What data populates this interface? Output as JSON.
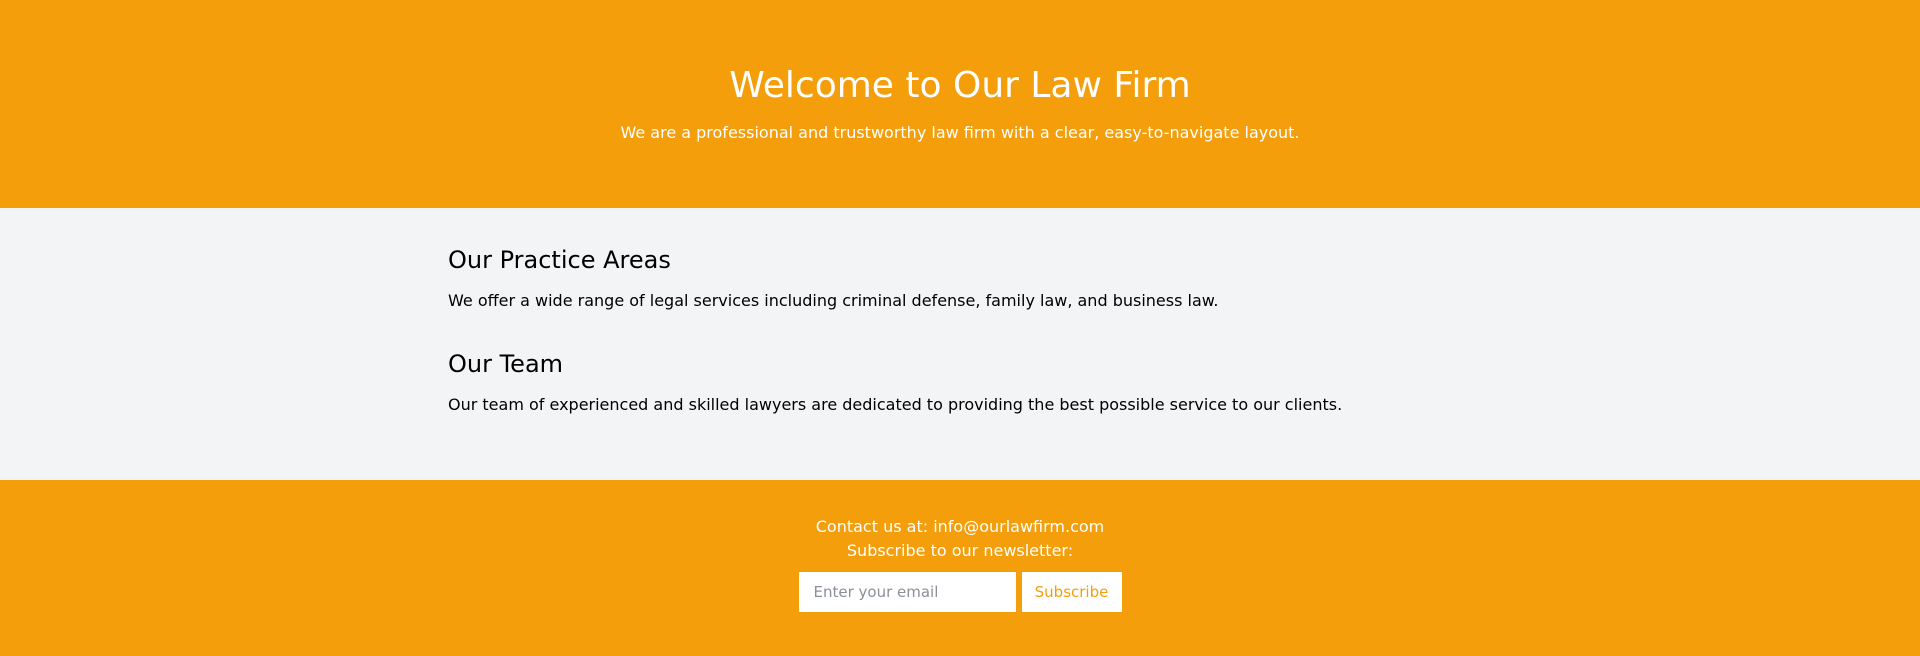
{
  "hero": {
    "title": "Welcome to Our Law Firm",
    "subtitle": "We are a professional and trustworthy law firm with a clear, easy-to-navigate layout."
  },
  "sections": [
    {
      "heading": "Our Practice Areas",
      "body": "We offer a wide range of legal services including criminal defense, family law, and business law."
    },
    {
      "heading": "Our Team",
      "body": "Our team of experienced and skilled lawyers are dedicated to providing the best possible service to our clients."
    }
  ],
  "footer": {
    "contact_text": "Contact us at: info@ourlawfirm.com",
    "newsletter_text": "Subscribe to our newsletter:",
    "email_placeholder": "Enter your email",
    "subscribe_label": "Subscribe"
  },
  "colors": {
    "accent": "#f49e0c",
    "content_background": "#f3f4f6",
    "text_light": "#ffffff",
    "text_dark": "#000000"
  }
}
